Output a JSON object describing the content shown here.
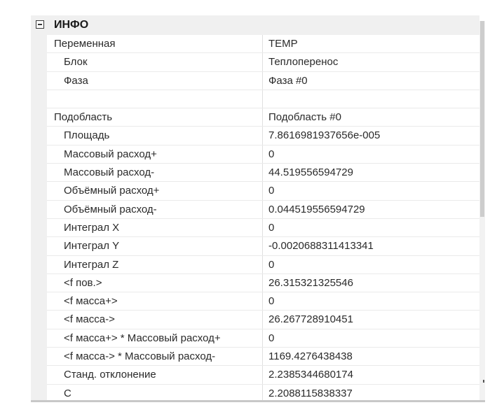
{
  "category": {
    "title": "ИНФО"
  },
  "rows": [
    {
      "name": "Переменная",
      "value": "TEMP",
      "level": 0
    },
    {
      "name": "Блок",
      "value": "Теплоперенос",
      "level": 1
    },
    {
      "name": "Фаза",
      "value": "Фаза #0",
      "level": 1
    },
    {
      "name": "",
      "value": "",
      "level": 0
    },
    {
      "name": "Подобласть",
      "value": "Подобласть #0",
      "level": 0
    },
    {
      "name": "Площадь",
      "value": "7.8616981937656e-005",
      "level": 1
    },
    {
      "name": "Массовый расход+",
      "value": "0",
      "level": 1
    },
    {
      "name": "Массовый расход-",
      "value": "44.519556594729",
      "level": 1
    },
    {
      "name": "Объёмный расход+",
      "value": "0",
      "level": 1
    },
    {
      "name": "Объёмный расход-",
      "value": "0.044519556594729",
      "level": 1
    },
    {
      "name": "Интеграл X",
      "value": "0",
      "level": 1
    },
    {
      "name": "Интеграл Y",
      "value": "-0.0020688311413341",
      "level": 1
    },
    {
      "name": "Интеграл Z",
      "value": "0",
      "level": 1
    },
    {
      "name": "<f пов.>",
      "value": "26.315321325546",
      "level": 1
    },
    {
      "name": "<f масса+>",
      "value": "0",
      "level": 1
    },
    {
      "name": "<f масса->",
      "value": "26.267728910451",
      "level": 1
    },
    {
      "name": "<f масса+> * Массовый расход+",
      "value": "0",
      "level": 1
    },
    {
      "name": "<f масса-> * Массовый расход-",
      "value": "1169.4276438438",
      "level": 1
    },
    {
      "name": "Станд. отклонение",
      "value": "2.2385344680174",
      "level": 1
    },
    {
      "name": "С",
      "value": "2.2088115838337",
      "level": 1
    }
  ]
}
